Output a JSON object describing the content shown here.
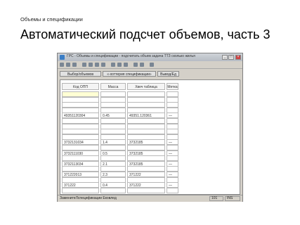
{
  "slide": {
    "subtitle": "Объемы и спецификации",
    "title": "Автоматический подсчет объемов, часть 3"
  },
  "window": {
    "title": "ГРС - Объемы и спецификации - подсчитать объем задача ТТЗ  сколько жилья",
    "controls": [
      "_",
      "□",
      "×"
    ]
  },
  "tabs": [
    {
      "label": "Выбор/объемов"
    },
    {
      "label": "«-хоттерия спецификации»"
    },
    {
      "label": "Вывод/Ед"
    }
  ],
  "table": {
    "headers": [
      "Код ОПП",
      "Масса",
      "Хвеч таблица",
      "Метка"
    ],
    "rows": [
      [
        "",
        "",
        "",
        ""
      ],
      [
        "",
        "",
        "",
        ""
      ],
      [
        "",
        "",
        "",
        ""
      ],
      [
        "",
        "",
        "",
        ""
      ],
      [
        "49351120304",
        "0.45",
        "49351.120361",
        "—"
      ],
      [
        "",
        "",
        "",
        ""
      ],
      [
        "",
        "",
        "",
        ""
      ],
      [
        "",
        "",
        "",
        ""
      ],
      [
        "",
        "",
        "",
        ""
      ],
      [
        "3732131034",
        "1.4",
        "3732185",
        "—"
      ],
      [
        "",
        "",
        "",
        ""
      ],
      [
        "3732111030",
        "0.5",
        "3732185",
        "—"
      ],
      [
        "",
        "",
        "",
        ""
      ],
      [
        "3732113034",
        "2.1",
        "3732185",
        "—"
      ],
      [
        "",
        "",
        "",
        ""
      ],
      [
        "371222013",
        "2.3",
        "371222",
        "—"
      ],
      [
        "",
        "",
        "",
        ""
      ],
      [
        "371222",
        "0.4",
        "371222",
        "—"
      ],
      [
        "",
        "",
        "",
        ""
      ]
    ]
  },
  "status": {
    "left": "ЗаменитеЛспецификации   Ековлед",
    "page": "101",
    "mode": "INS"
  },
  "colors": {
    "window_bg": "#d4d0c8",
    "titlebar": "#cfd3d8",
    "selected_row": "#ffffd4"
  }
}
